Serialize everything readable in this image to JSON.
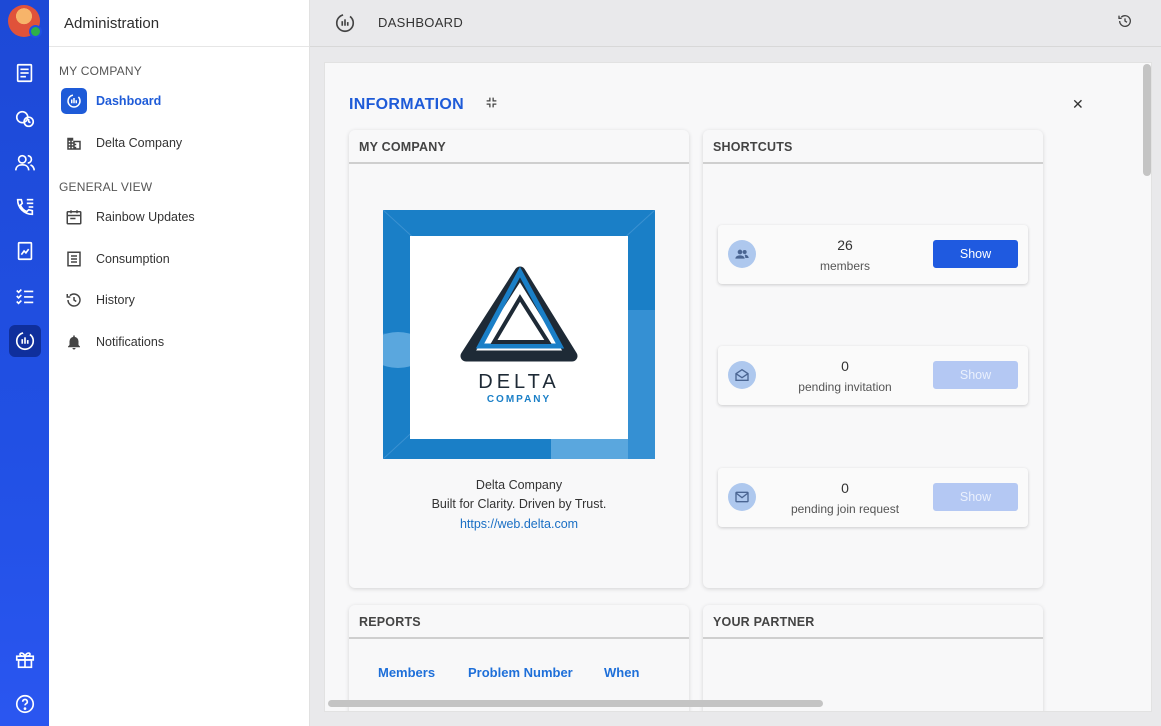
{
  "rail": {
    "icons": [
      "avatar",
      "news-icon",
      "rainbow-calls-icon",
      "users-icon",
      "phone-list-icon",
      "report-icon",
      "checklist-icon",
      "dashboard-icon",
      "gift-icon",
      "help-icon"
    ],
    "accent": "#2150e4"
  },
  "sidebar": {
    "title": "Administration",
    "section_company": "MY COMPANY",
    "section_general": "GENERAL VIEW",
    "items": [
      {
        "label": "Dashboard",
        "icon": "dashboard-icon",
        "active": true
      },
      {
        "label": "Delta Company",
        "icon": "building-icon"
      },
      {
        "label": "Rainbow Updates",
        "icon": "calendar-icon"
      },
      {
        "label": "Consumption",
        "icon": "receipt-icon"
      },
      {
        "label": "History",
        "icon": "history-icon"
      },
      {
        "label": "Notifications",
        "icon": "bell-icon"
      }
    ]
  },
  "topbar": {
    "label": "DASHBOARD"
  },
  "main": {
    "title": "INFORMATION",
    "my_company": {
      "header": "MY COMPANY",
      "logo_text": "DELTA",
      "logo_subtext": "COMPANY",
      "name": "Delta Company",
      "tagline": "Built for Clarity. Driven by Trust.",
      "url": "https://web.delta.com"
    },
    "shortcuts": {
      "header": "SHORTCUTS",
      "items": [
        {
          "count": "26",
          "label": "members",
          "button": "Show",
          "enabled": true
        },
        {
          "count": "0",
          "label": "pending invitation",
          "button": "Show",
          "enabled": false
        },
        {
          "count": "0",
          "label": "pending join request",
          "button": "Show",
          "enabled": false
        }
      ]
    },
    "reports": {
      "header": "REPORTS",
      "tabs": [
        "Members",
        "Problem Number",
        "When"
      ]
    },
    "partner": {
      "header": "YOUR PARTNER"
    }
  }
}
